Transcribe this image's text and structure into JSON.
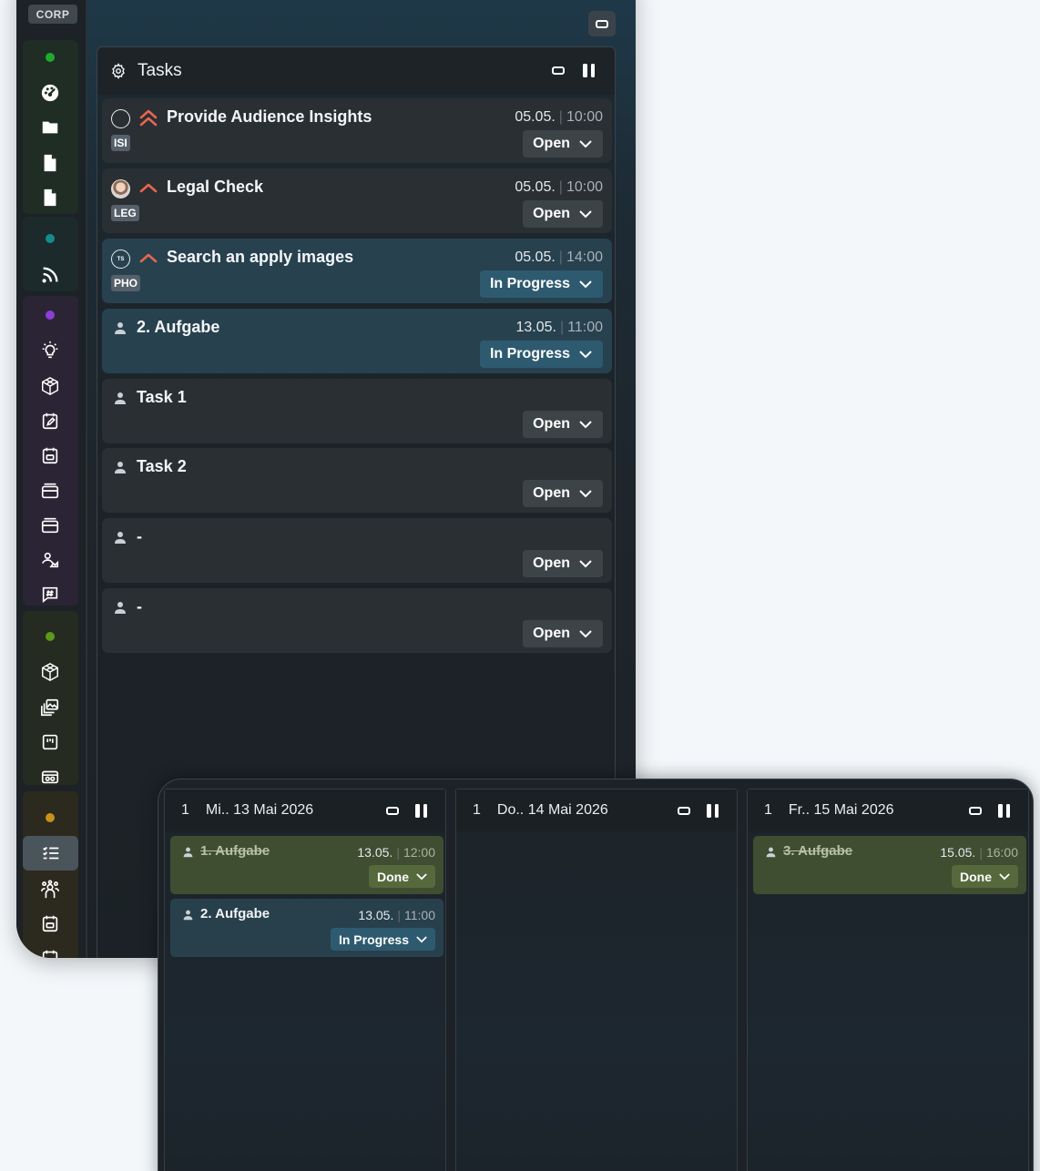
{
  "rail": {
    "badge": "CORP"
  },
  "tasks_panel": {
    "title": "Tasks",
    "items": [
      {
        "title": "Provide Audience Insights",
        "tag": "ISI",
        "date": "05.05.",
        "time": "10:00",
        "status": "Open",
        "lead": "empty-circle",
        "priority": "high"
      },
      {
        "title": "Legal Check",
        "tag": "LEG",
        "date": "05.05.",
        "time": "10:00",
        "status": "Open",
        "lead": "photo",
        "priority": "medium"
      },
      {
        "title": "Search an apply images",
        "tag": "PHO",
        "date": "05.05.",
        "time": "14:00",
        "status": "In Progress",
        "lead": "TS",
        "priority": "medium"
      },
      {
        "title": "2. Aufgabe",
        "tag": "",
        "date": "13.05.",
        "time": "11:00",
        "status": "In Progress",
        "lead": "person"
      },
      {
        "title": "Task 1",
        "tag": "",
        "date": "",
        "time": "",
        "status": "Open",
        "lead": "person"
      },
      {
        "title": "Task 2",
        "tag": "",
        "date": "",
        "time": "",
        "status": "Open",
        "lead": "person"
      },
      {
        "title": "-",
        "tag": "",
        "date": "",
        "time": "",
        "status": "Open",
        "lead": "person"
      },
      {
        "title": "-",
        "tag": "",
        "date": "",
        "time": "",
        "status": "Open",
        "lead": "person"
      }
    ]
  },
  "calendar": {
    "columns": [
      {
        "count": "1",
        "title": "Mi.. 13 Mai 2026",
        "cards": [
          {
            "title": "1. Aufgabe",
            "date": "13.05.",
            "time": "12:00",
            "status": "Done"
          },
          {
            "title": "2. Aufgabe",
            "date": "13.05.",
            "time": "11:00",
            "status": "In Progress"
          }
        ]
      },
      {
        "count": "1",
        "title": "Do.. 14 Mai 2026",
        "cards": []
      },
      {
        "count": "1",
        "title": "Fr.. 15 Mai 2026",
        "cards": [
          {
            "title": "3. Aufgabe",
            "date": "15.05.",
            "time": "16:00",
            "status": "Done"
          }
        ]
      }
    ]
  },
  "colors": {
    "priority_high": "#e8664f",
    "in_progress": "#2e5a70",
    "done": "#56693c",
    "dot_green": "#1faa2e",
    "dot_teal": "#138c8c",
    "dot_purple": "#8b3fd6",
    "dot_olive": "#5a9a1a",
    "dot_amber": "#c7921a"
  }
}
